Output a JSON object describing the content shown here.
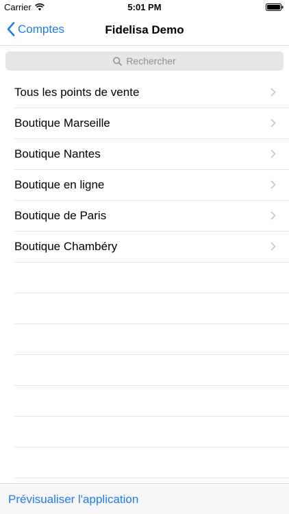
{
  "status_bar": {
    "carrier": "Carrier",
    "time": "5:01 PM",
    "wifi_icon": "wifi-icon",
    "battery_icon": "battery-icon"
  },
  "nav": {
    "back_label": "Comptes",
    "title": "Fidelisa Demo",
    "back_icon": "chevron-left-icon"
  },
  "search": {
    "placeholder": "Rechercher",
    "icon": "search-icon"
  },
  "stores": [
    {
      "label": "Tous les points de vente"
    },
    {
      "label": "Boutique Marseille"
    },
    {
      "label": "Boutique Nantes"
    },
    {
      "label": "Boutique en ligne"
    },
    {
      "label": "Boutique de Paris"
    },
    {
      "label": "Boutique Chambéry"
    }
  ],
  "toolbar": {
    "preview_label": "Prévisualiser l'application"
  },
  "colors": {
    "accent": "#1a7cf2",
    "placeholder": "#8e8e93",
    "separator": "#e3e3e3"
  }
}
